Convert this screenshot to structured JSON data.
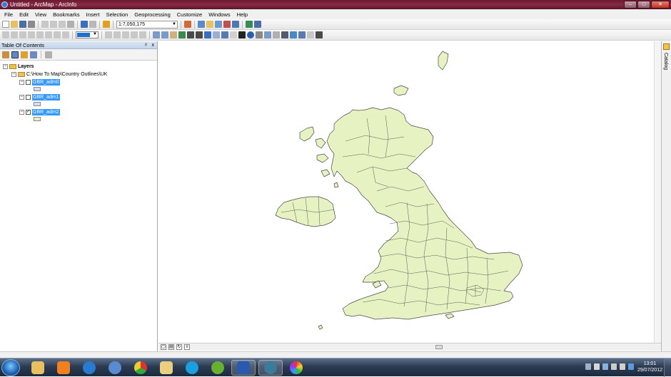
{
  "window": {
    "title": "Untitled - ArcMap - ArcInfo",
    "minimize": "–",
    "maximize": "□",
    "close": "✕"
  },
  "menu": [
    "File",
    "Edit",
    "View",
    "Bookmarks",
    "Insert",
    "Selection",
    "Geoprocessing",
    "Customize",
    "Windows",
    "Help"
  ],
  "toolbar": {
    "scale_value": "1:7,050,175",
    "dropdown_glyph": "▼"
  },
  "toc": {
    "title": "Table Of Contents",
    "pin_glyph": "ᵖ",
    "close_glyph": "x",
    "root": "Layers",
    "folder": "C:\\How To Map\\Country Outlines\\UK",
    "layers": [
      {
        "name": "GBR_adm0",
        "checked": false
      },
      {
        "name": "GBR_adm1",
        "checked": false
      },
      {
        "name": "GBR_adm2",
        "checked": true
      }
    ]
  },
  "map": {
    "land_color": "#e6f2c2",
    "boundary_color": "#4a4a4a"
  },
  "catalog": {
    "label": "Catalog"
  },
  "taskbar": {
    "time": "13:01",
    "date": "29/07/2012"
  },
  "colors": {
    "title_bar": "#7a2440",
    "selection": "#3399ff",
    "taskbar": "#2c3b52"
  }
}
